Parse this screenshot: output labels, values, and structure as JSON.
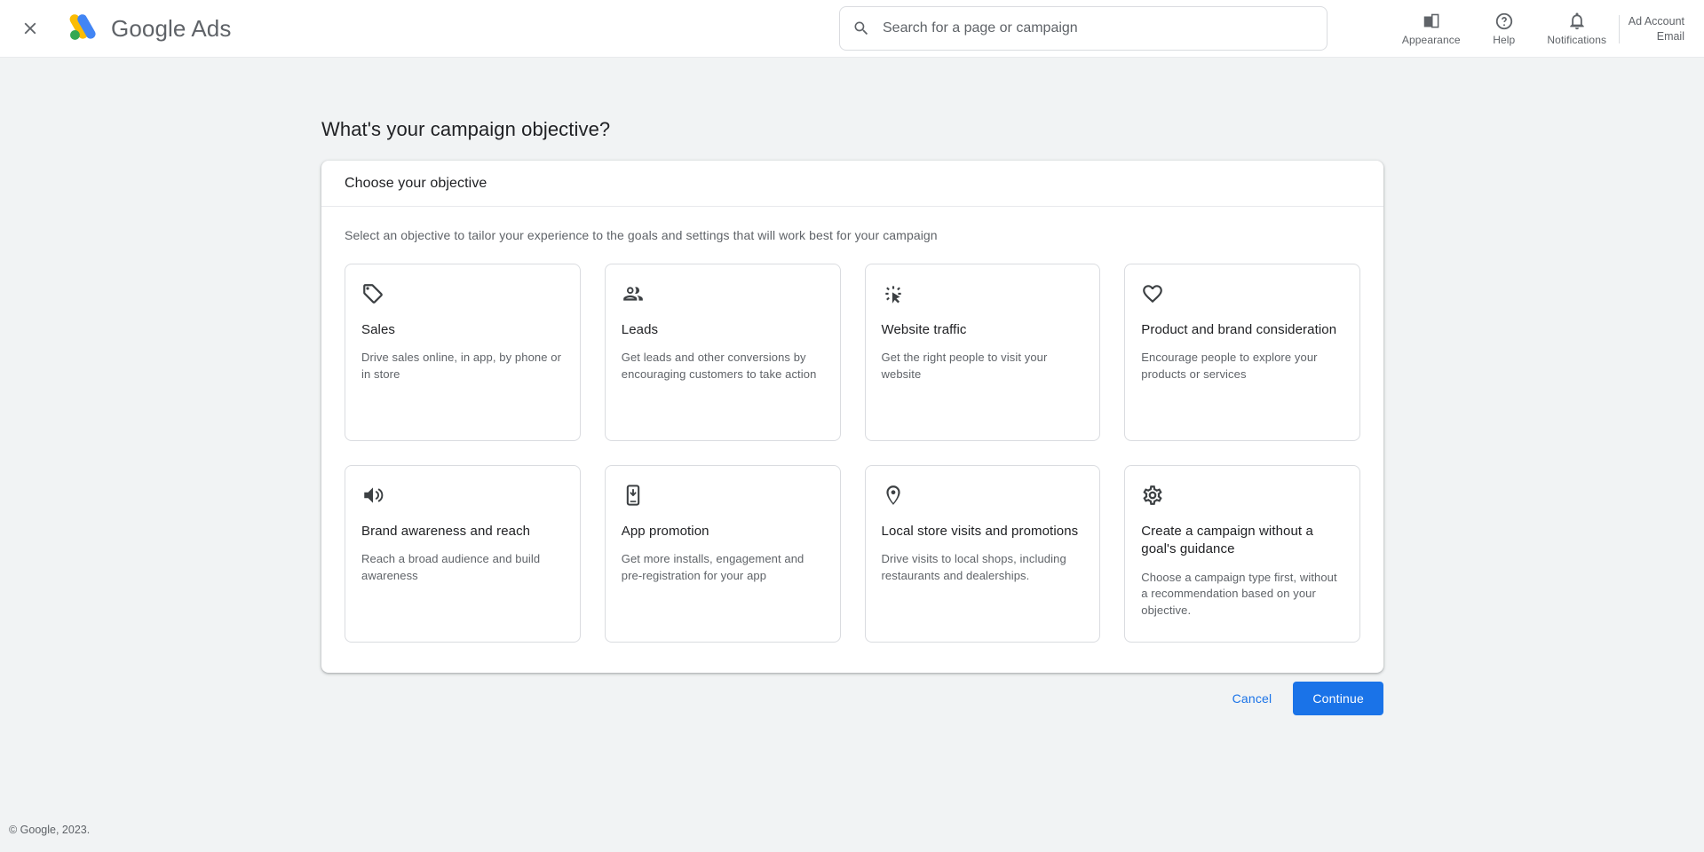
{
  "header": {
    "close_icon": "close-icon",
    "brand_primary": "Google",
    "brand_secondary": "Ads",
    "search": {
      "icon": "search-icon",
      "placeholder": "Search for a page or campaign",
      "value": ""
    },
    "items": [
      {
        "label": "Appearance",
        "icon": "appearance-icon"
      },
      {
        "label": "Help",
        "icon": "help-icon"
      },
      {
        "label": "Notifications",
        "icon": "bell-icon"
      }
    ],
    "account": {
      "line1": "Ad Account",
      "line2": "Email"
    }
  },
  "page": {
    "title": "What's your campaign objective?",
    "copyright": "© Google, 2023."
  },
  "card": {
    "header": "Choose your objective",
    "subtitle": "Select an objective to tailor your experience to the goals and settings that will work best for your campaign",
    "objectives": [
      {
        "icon": "tag-icon",
        "title": "Sales",
        "description": "Drive sales online, in app, by phone or in store"
      },
      {
        "icon": "people-icon",
        "title": "Leads",
        "description": "Get leads and other conversions by encouraging customers to take action"
      },
      {
        "icon": "ad-click-icon",
        "title": "Website traffic",
        "description": "Get the right people to visit your website"
      },
      {
        "icon": "heart-icon",
        "title": "Product and brand consideration",
        "description": "Encourage people to explore your products or services"
      },
      {
        "icon": "speaker-icon",
        "title": "Brand awareness and reach",
        "description": "Reach a broad audience and build awareness"
      },
      {
        "icon": "phone-download-icon",
        "title": "App promotion",
        "description": "Get more installs, engagement and pre-registration for your app"
      },
      {
        "icon": "location-pin-icon",
        "title": "Local store visits and promotions",
        "description": "Drive visits to local shops, including restaurants and dealerships."
      },
      {
        "icon": "gear-icon",
        "title": "Create a campaign without a goal's guidance",
        "description": "Choose a campaign type first, without a recommendation based on your objective."
      }
    ]
  },
  "actions": {
    "cancel_label": "Cancel",
    "continue_label": "Continue"
  },
  "colors": {
    "accent": "#1a73e8",
    "page_background": "#f1f3f4",
    "text_primary": "#202124",
    "text_secondary": "#5f6368",
    "border": "#dadce0",
    "logo_green": "#34a853",
    "logo_yellow": "#fbbc04",
    "logo_blue": "#4285f4"
  }
}
